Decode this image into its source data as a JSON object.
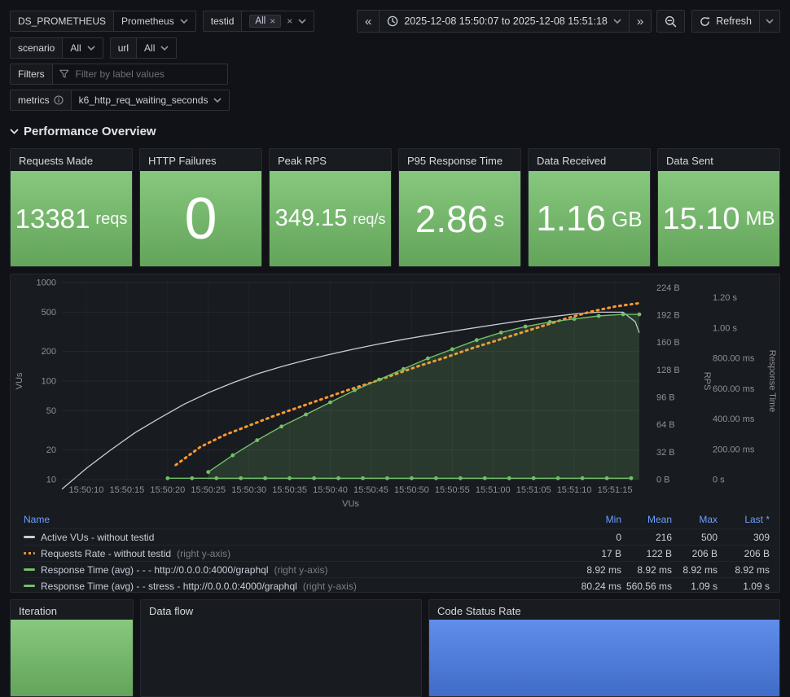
{
  "colors": {
    "stat_green": "#73bf69",
    "stat_blue": "#4a7ee8",
    "accent_blue": "#6e9fff",
    "orange": "#ff9830",
    "gray_series": "#c8cdd9"
  },
  "variables": {
    "datasource": {
      "label": "DS_PROMETHEUS",
      "value": "Prometheus"
    },
    "testid": {
      "label": "testid",
      "chip": "All"
    },
    "scenario": {
      "label": "scenario",
      "value": "All"
    },
    "url": {
      "label": "url",
      "value": "All"
    },
    "filters": {
      "label": "Filters",
      "placeholder": "Filter by label values"
    },
    "metrics": {
      "label": "metrics",
      "value": "k6_http_req_waiting_seconds"
    }
  },
  "timebar": {
    "range": "2025-12-08 15:50:07 to 2025-12-08 15:51:18",
    "refresh_label": "Refresh"
  },
  "section": {
    "title": "Performance Overview"
  },
  "stats": [
    {
      "title": "Requests Made",
      "value": "13381",
      "unit": "reqs"
    },
    {
      "title": "HTTP Failures",
      "value": "0",
      "unit": ""
    },
    {
      "title": "Peak RPS",
      "value": "349.15",
      "unit": "req/s"
    },
    {
      "title": "P95 Response Time",
      "value": "2.86",
      "unit": "s"
    },
    {
      "title": "Data Received",
      "value": "1.16",
      "unit": "GB"
    },
    {
      "title": "Data Sent",
      "value": "15.10",
      "unit": "MB"
    }
  ],
  "chart_data": {
    "type": "line",
    "xlabel": "VUs",
    "t_range": [
      0,
      71
    ],
    "x_ticks": [
      "15:50:10",
      "15:50:15",
      "15:50:20",
      "15:50:25",
      "15:50:30",
      "15:50:35",
      "15:50:40",
      "15:50:45",
      "15:50:50",
      "15:50:55",
      "15:51:00",
      "15:51:05",
      "15:51:10",
      "15:51:15"
    ],
    "x_tick_t": [
      3,
      8,
      13,
      18,
      23,
      28,
      33,
      38,
      43,
      48,
      53,
      58,
      63,
      68
    ],
    "left_axis": {
      "label": "VUs",
      "scale": "log",
      "range": [
        10,
        1000
      ],
      "tick_values": [
        10,
        20,
        50,
        100,
        200,
        500,
        1000
      ],
      "tick_labels": [
        "10",
        "20",
        "50",
        "100",
        "200",
        "500",
        "1000"
      ]
    },
    "right_axis_rps": {
      "label": "RPS",
      "range": [
        0,
        230
      ],
      "tick_values": [
        0,
        32,
        64,
        96,
        128,
        160,
        192,
        224
      ],
      "tick_labels": [
        "0 B",
        "32 B",
        "64 B",
        "96 B",
        "128 B",
        "160 B",
        "192 B",
        "224 B"
      ]
    },
    "right_axis_rt": {
      "label": "Response Time",
      "range": [
        0,
        1.3
      ],
      "tick_values": [
        0,
        0.2,
        0.4,
        0.6,
        0.8,
        1.0,
        1.2
      ],
      "tick_labels": [
        "0 s",
        "200.00 ms",
        "400.00 ms",
        "600.00 ms",
        "800.00 ms",
        "1.00 s",
        "1.20 s"
      ]
    },
    "series": [
      {
        "name": "Active VUs - without testid",
        "axis": "vus",
        "color": "#c8cdd9",
        "width": 1.3,
        "dashed": false,
        "markers": false,
        "area": false,
        "points": [
          [
            0,
            8
          ],
          [
            3,
            13
          ],
          [
            6,
            20
          ],
          [
            9,
            30
          ],
          [
            12,
            42
          ],
          [
            15,
            58
          ],
          [
            18,
            76
          ],
          [
            21,
            96
          ],
          [
            24,
            118
          ],
          [
            27,
            140
          ],
          [
            30,
            163
          ],
          [
            33,
            187
          ],
          [
            36,
            212
          ],
          [
            39,
            238
          ],
          [
            42,
            265
          ],
          [
            45,
            292
          ],
          [
            48,
            320
          ],
          [
            51,
            350
          ],
          [
            54,
            382
          ],
          [
            57,
            415
          ],
          [
            60,
            448
          ],
          [
            63,
            480
          ],
          [
            66,
            500
          ],
          [
            69,
            500
          ],
          [
            70.5,
            400
          ],
          [
            71,
            309
          ]
        ]
      },
      {
        "name": "Requests Rate - without testid",
        "axis": "rps",
        "color": "#ff9830",
        "width": 3,
        "dashed": true,
        "markers": false,
        "area": false,
        "points": [
          [
            14,
            17
          ],
          [
            17,
            38
          ],
          [
            20,
            52
          ],
          [
            23,
            63
          ],
          [
            26,
            74
          ],
          [
            29,
            84
          ],
          [
            32,
            94
          ],
          [
            35,
            104
          ],
          [
            38,
            113
          ],
          [
            41,
            123
          ],
          [
            44,
            133
          ],
          [
            47,
            142
          ],
          [
            50,
            152
          ],
          [
            53,
            161
          ],
          [
            56,
            170
          ],
          [
            59,
            179
          ],
          [
            62,
            188
          ],
          [
            65,
            196
          ],
          [
            68,
            202
          ],
          [
            71,
            206
          ]
        ]
      },
      {
        "name": "Response Time (avg) - - - http://0.0.0.0:4000/graphql",
        "axis": "rt",
        "color": "#73bf69",
        "width": 1.4,
        "dashed": false,
        "markers": true,
        "area": false,
        "points": [
          [
            13,
            0.00892
          ],
          [
            16,
            0.00892
          ],
          [
            19,
            0.00892
          ],
          [
            22,
            0.00892
          ],
          [
            25,
            0.00892
          ],
          [
            28,
            0.00892
          ],
          [
            31,
            0.00892
          ],
          [
            34,
            0.00892
          ],
          [
            37,
            0.00892
          ],
          [
            40,
            0.00892
          ],
          [
            43,
            0.00892
          ],
          [
            46,
            0.00892
          ],
          [
            49,
            0.00892
          ],
          [
            52,
            0.00892
          ],
          [
            55,
            0.00892
          ],
          [
            58,
            0.00892
          ],
          [
            61,
            0.00892
          ],
          [
            64,
            0.00892
          ],
          [
            67,
            0.00892
          ],
          [
            70,
            0.00892
          ]
        ]
      },
      {
        "name": "Response Time (avg) - - stress - http://0.0.0.0:4000/graphql",
        "axis": "rt",
        "color": "#73bf69",
        "width": 1.4,
        "dashed": false,
        "markers": true,
        "area": true,
        "points": [
          [
            18,
            0.05
          ],
          [
            21,
            0.16
          ],
          [
            24,
            0.26
          ],
          [
            27,
            0.35
          ],
          [
            30,
            0.43
          ],
          [
            33,
            0.51
          ],
          [
            36,
            0.59
          ],
          [
            39,
            0.66
          ],
          [
            42,
            0.73
          ],
          [
            45,
            0.8
          ],
          [
            48,
            0.86
          ],
          [
            51,
            0.92
          ],
          [
            54,
            0.97
          ],
          [
            57,
            1.01
          ],
          [
            60,
            1.04
          ],
          [
            63,
            1.06
          ],
          [
            66,
            1.08
          ],
          [
            69,
            1.09
          ],
          [
            71,
            1.09
          ]
        ]
      }
    ]
  },
  "legend": {
    "columns": [
      "Name",
      "Min",
      "Mean",
      "Max",
      "Last *"
    ],
    "rows": [
      {
        "name": "Active VUs - without testid",
        "suffix": "",
        "min": "0",
        "mean": "216",
        "max": "500",
        "last": "309",
        "color": "#c8cdd9",
        "dashed": false
      },
      {
        "name": "Requests Rate - without testid",
        "suffix": "(right y-axis)",
        "min": "17 B",
        "mean": "122 B",
        "max": "206 B",
        "last": "206 B",
        "color": "#ff9830",
        "dashed": true
      },
      {
        "name": "Response Time (avg) - - - http://0.0.0.0:4000/graphql",
        "suffix": "(right y-axis)",
        "min": "8.92 ms",
        "mean": "8.92 ms",
        "max": "8.92 ms",
        "last": "8.92 ms",
        "color": "#73bf69",
        "dashed": false
      },
      {
        "name": "Response Time (avg) - - stress - http://0.0.0.0:4000/graphql",
        "suffix": "(right y-axis)",
        "min": "80.24 ms",
        "mean": "560.56 ms",
        "max": "1.09 s",
        "last": "1.09 s",
        "color": "#73bf69",
        "dashed": false
      }
    ]
  },
  "bottom_panels": [
    {
      "title": "Iteration"
    },
    {
      "title": "Data flow"
    },
    {
      "title": "Code Status Rate"
    }
  ]
}
